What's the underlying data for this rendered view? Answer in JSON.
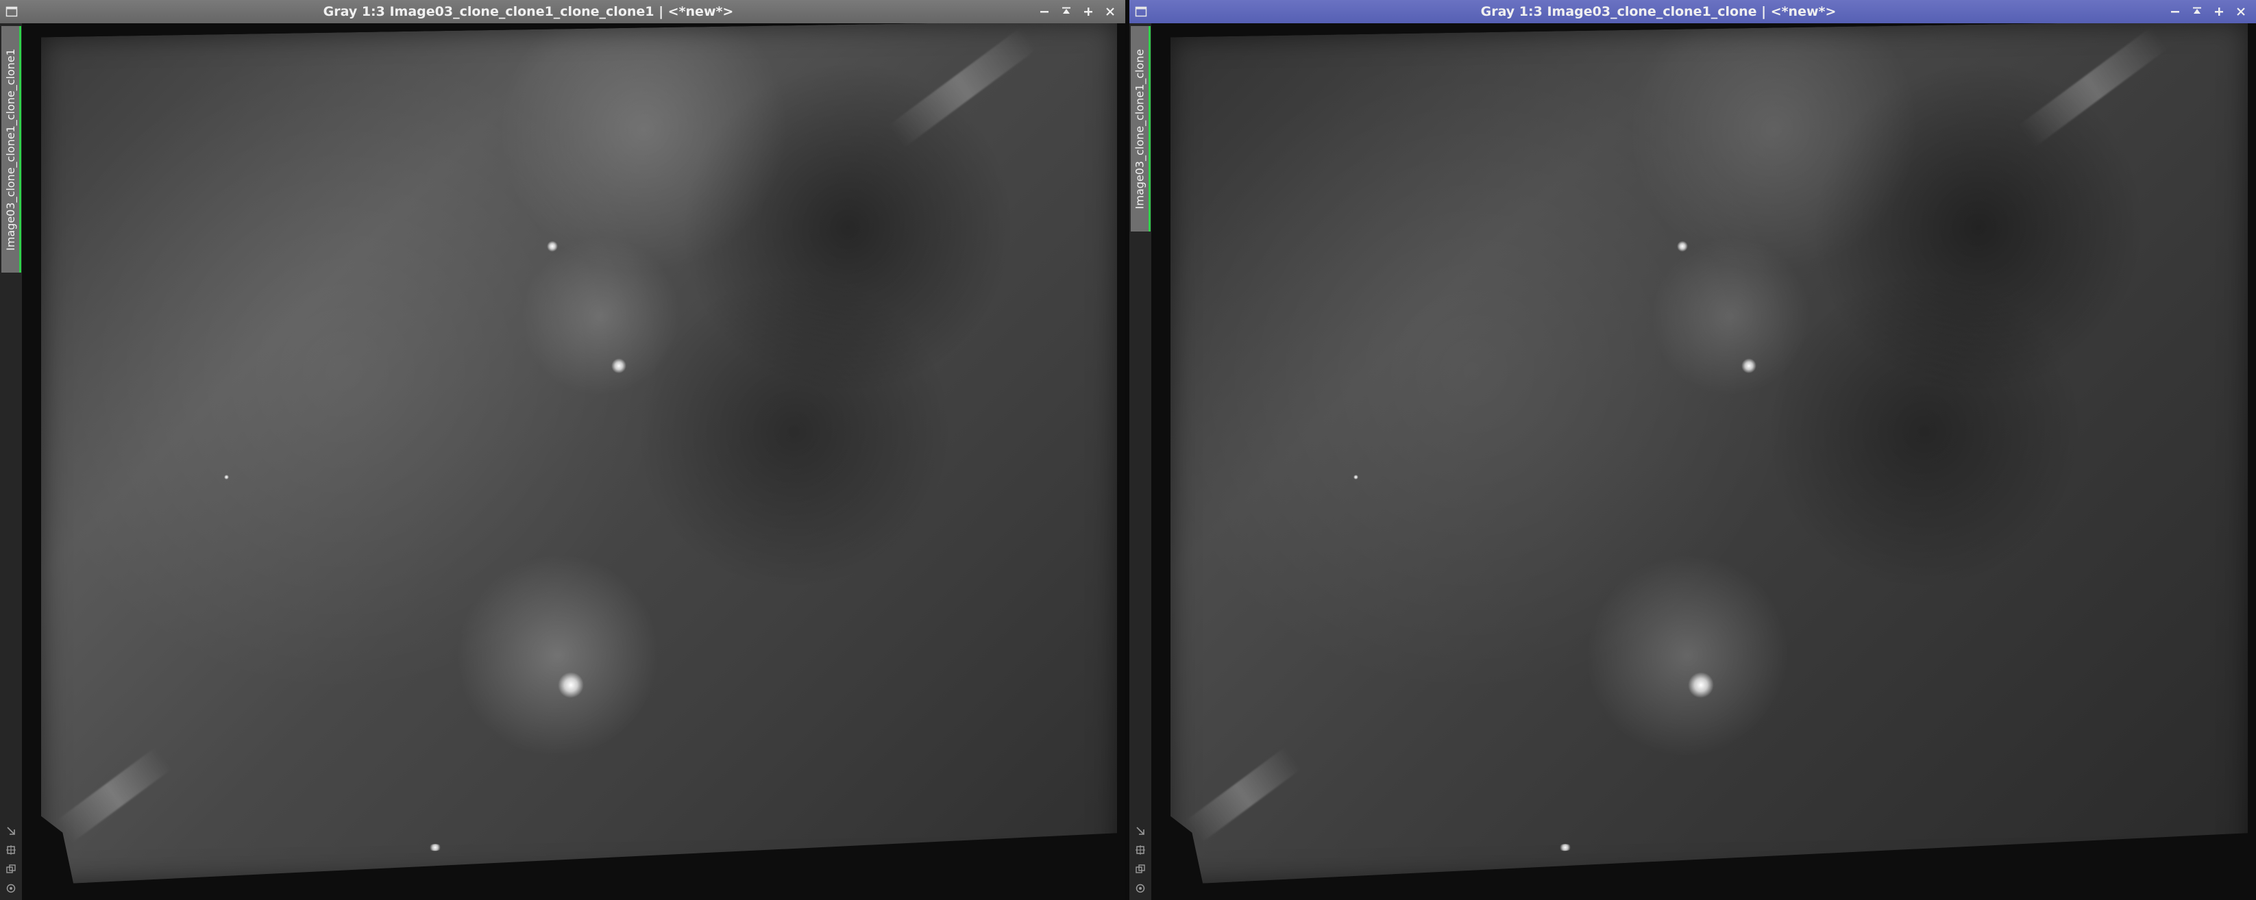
{
  "windows": [
    {
      "id": "left",
      "title": "Gray 1:3 Image03_clone_clone1_clone_clone1 | <*new*>",
      "active": false,
      "side_tab_label": "Image03_clone_clone1_clone_clone1"
    },
    {
      "id": "right",
      "title": "Gray 1:3 Image03_clone_clone1_clone | <*new*>",
      "active": true,
      "side_tab_label": "Image03_clone_clone1_clone"
    }
  ],
  "icons": {
    "window_menu": "window-icon",
    "minimize": "minimize-icon",
    "shade": "shade-icon",
    "maximize": "maximize-icon",
    "close": "close-icon",
    "tools": [
      "resize-icon",
      "fit-view-icon",
      "copy-icon",
      "settings-icon"
    ]
  },
  "colors": {
    "active_title": "#5660b4",
    "inactive_title": "#666666",
    "tab_accent": "#2fd14a"
  }
}
